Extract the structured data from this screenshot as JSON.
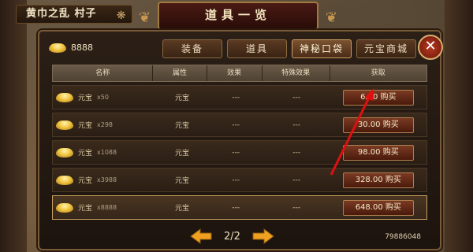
{
  "location": {
    "text": "黄巾之乱 村子"
  },
  "title": "道具一览",
  "currency": {
    "icon": "gold-ingot-icon",
    "amount": "8888"
  },
  "tabs": [
    {
      "label": "装备",
      "active": false
    },
    {
      "label": "道具",
      "active": false
    },
    {
      "label": "神秘口袋",
      "active": true
    },
    {
      "label": "元宝商城",
      "active": false
    }
  ],
  "close_label": "✕",
  "table": {
    "headers": [
      "名称",
      "属性",
      "效果",
      "特殊效果",
      "获取"
    ],
    "rows": [
      {
        "name": "元宝",
        "qty": "x50",
        "attr": "元宝",
        "effect": "---",
        "special": "---",
        "price": "6.00 购买"
      },
      {
        "name": "元宝",
        "qty": "x298",
        "attr": "元宝",
        "effect": "---",
        "special": "---",
        "price": "30.00 购买"
      },
      {
        "name": "元宝",
        "qty": "x1088",
        "attr": "元宝",
        "effect": "---",
        "special": "---",
        "price": "98.00 购买"
      },
      {
        "name": "元宝",
        "qty": "x3988",
        "attr": "元宝",
        "effect": "---",
        "special": "---",
        "price": "328.00 购买"
      },
      {
        "name": "元宝",
        "qty": "x8888",
        "attr": "元宝",
        "effect": "---",
        "special": "---",
        "price": "648.00 购买"
      }
    ]
  },
  "pager": {
    "text": "2/2"
  },
  "player_id": "79886048",
  "colors": {
    "accent": "#d0a060",
    "arrow": "#f0a020",
    "pointer": "#e01010"
  }
}
